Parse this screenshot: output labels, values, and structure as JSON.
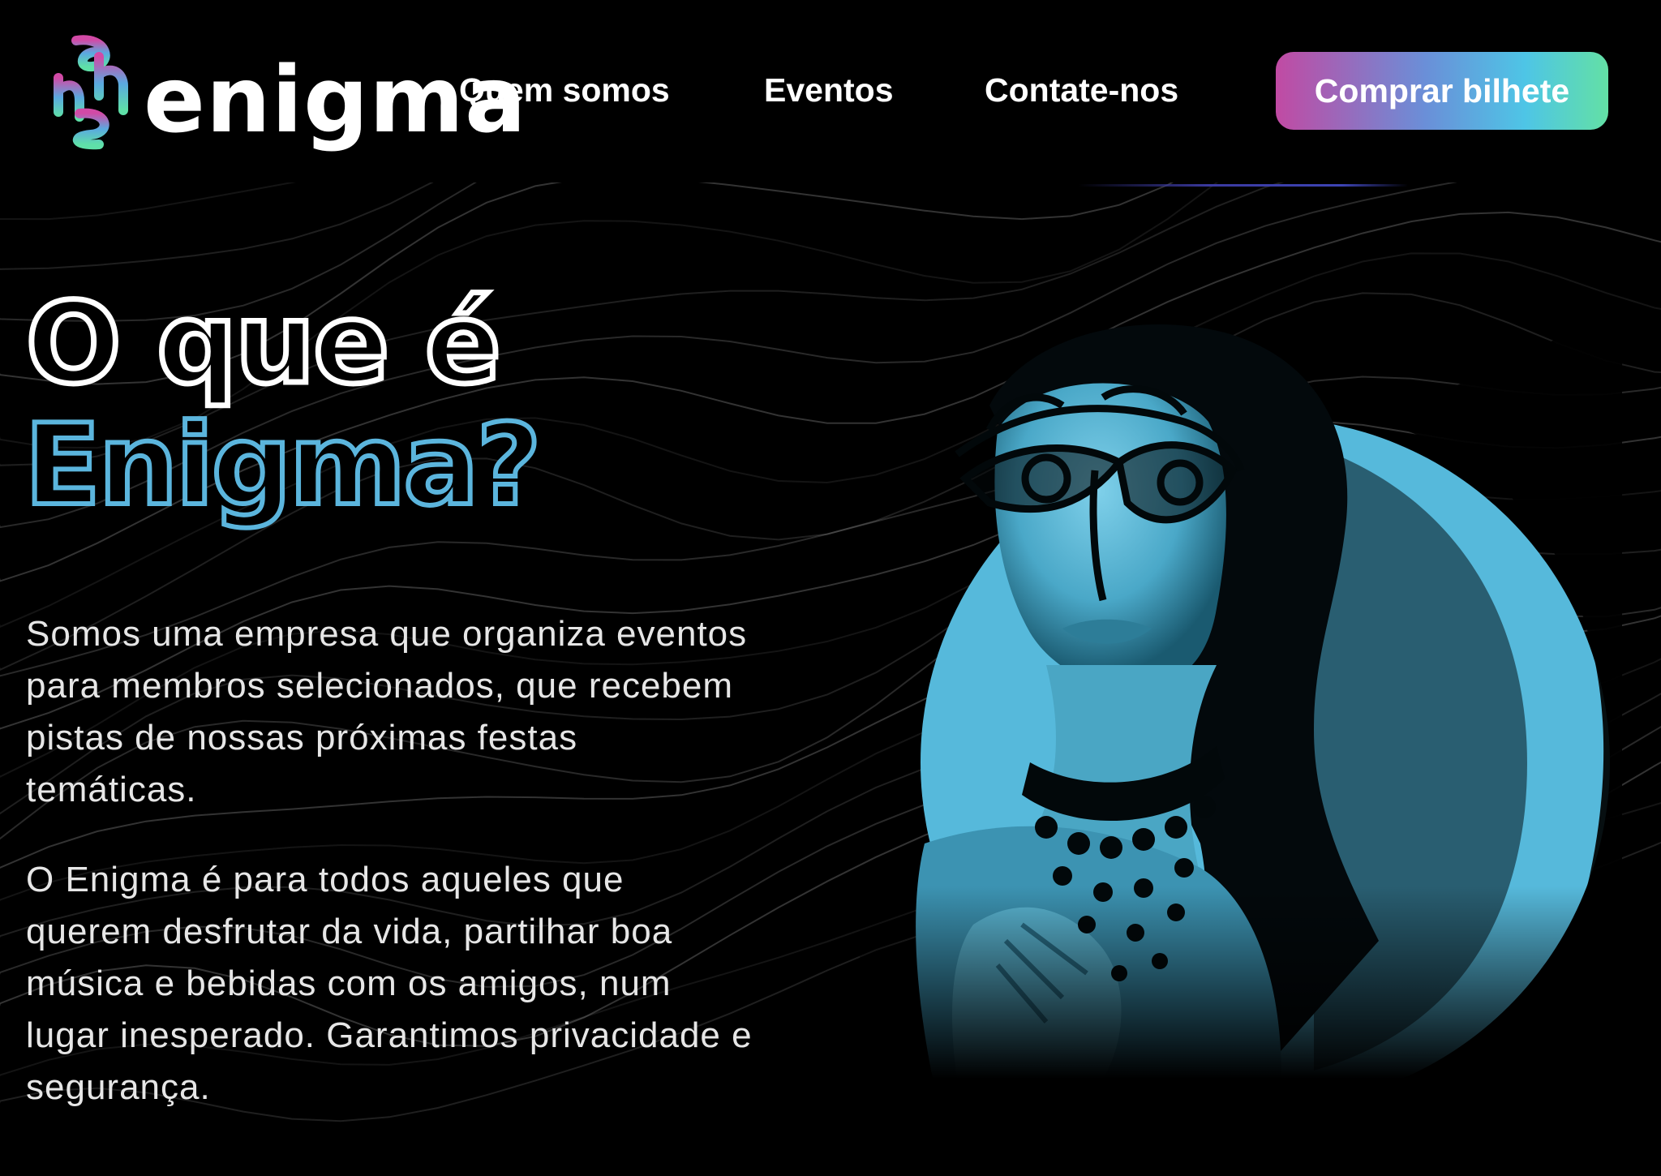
{
  "brand": {
    "name": "enigma",
    "colors": {
      "pink": "#c14aa3",
      "blue": "#5bb5dd",
      "green": "#63e0a5"
    }
  },
  "nav": {
    "items": [
      {
        "label": "Quem somos"
      },
      {
        "label": "Eventos"
      },
      {
        "label": "Contate-nos"
      }
    ],
    "cta_label": "Comprar bilhete"
  },
  "hero": {
    "title_line1": "O que é",
    "title_line2": "Enigma?",
    "paragraph1": "Somos uma empresa que organiza eventos para membros selecionados, que recebem pistas de nossas próximas festas temáticas.",
    "paragraph2": "O Enigma é para todos aqueles que querem desfrutar da vida, partilhar boa música e bebidas com os amigos, num lugar inesperado. Garantimos privacidade e segurança.",
    "image_subject": "masked-woman-portrait",
    "circle_color": "#56b9db"
  }
}
